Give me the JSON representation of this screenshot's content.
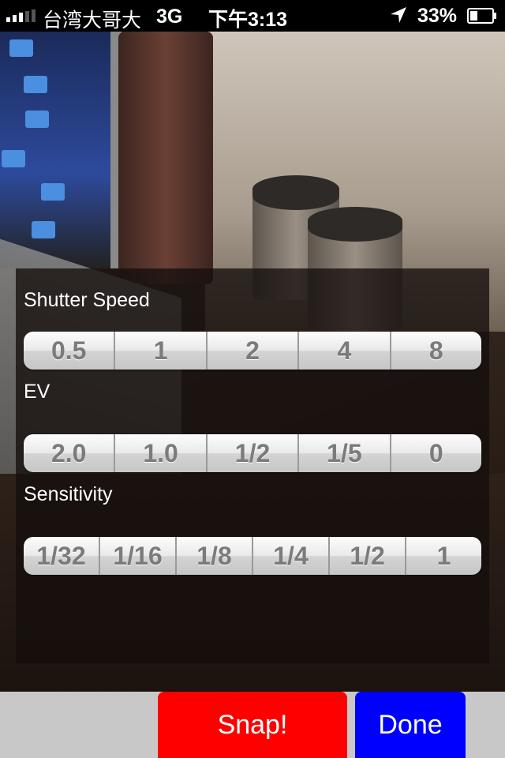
{
  "status_bar": {
    "carrier": "台湾大哥大",
    "network": "3G",
    "time": "下午3:13",
    "battery_percent": "33%",
    "icons": [
      "signal-strength-icon",
      "location-arrow-icon",
      "battery-icon"
    ]
  },
  "camera": {
    "icons": [
      "camera-preview"
    ]
  },
  "settings": {
    "shutter_speed": {
      "label": "Shutter Speed",
      "options": [
        "0.5",
        "1",
        "2",
        "4",
        "8"
      ]
    },
    "ev": {
      "label": "EV",
      "options": [
        "2.0",
        "1.0",
        "1/2",
        "1/5",
        "0"
      ]
    },
    "sensitivity": {
      "label": "Sensitivity",
      "options": [
        "1/32",
        "1/16",
        "1/8",
        "1/4",
        "1/2",
        "1"
      ]
    }
  },
  "toolbar": {
    "snap_label": "Snap!",
    "done_label": "Done",
    "snap_color": "#ff0000",
    "done_color": "#0000ff",
    "bar_color": "#c8c8c8"
  }
}
